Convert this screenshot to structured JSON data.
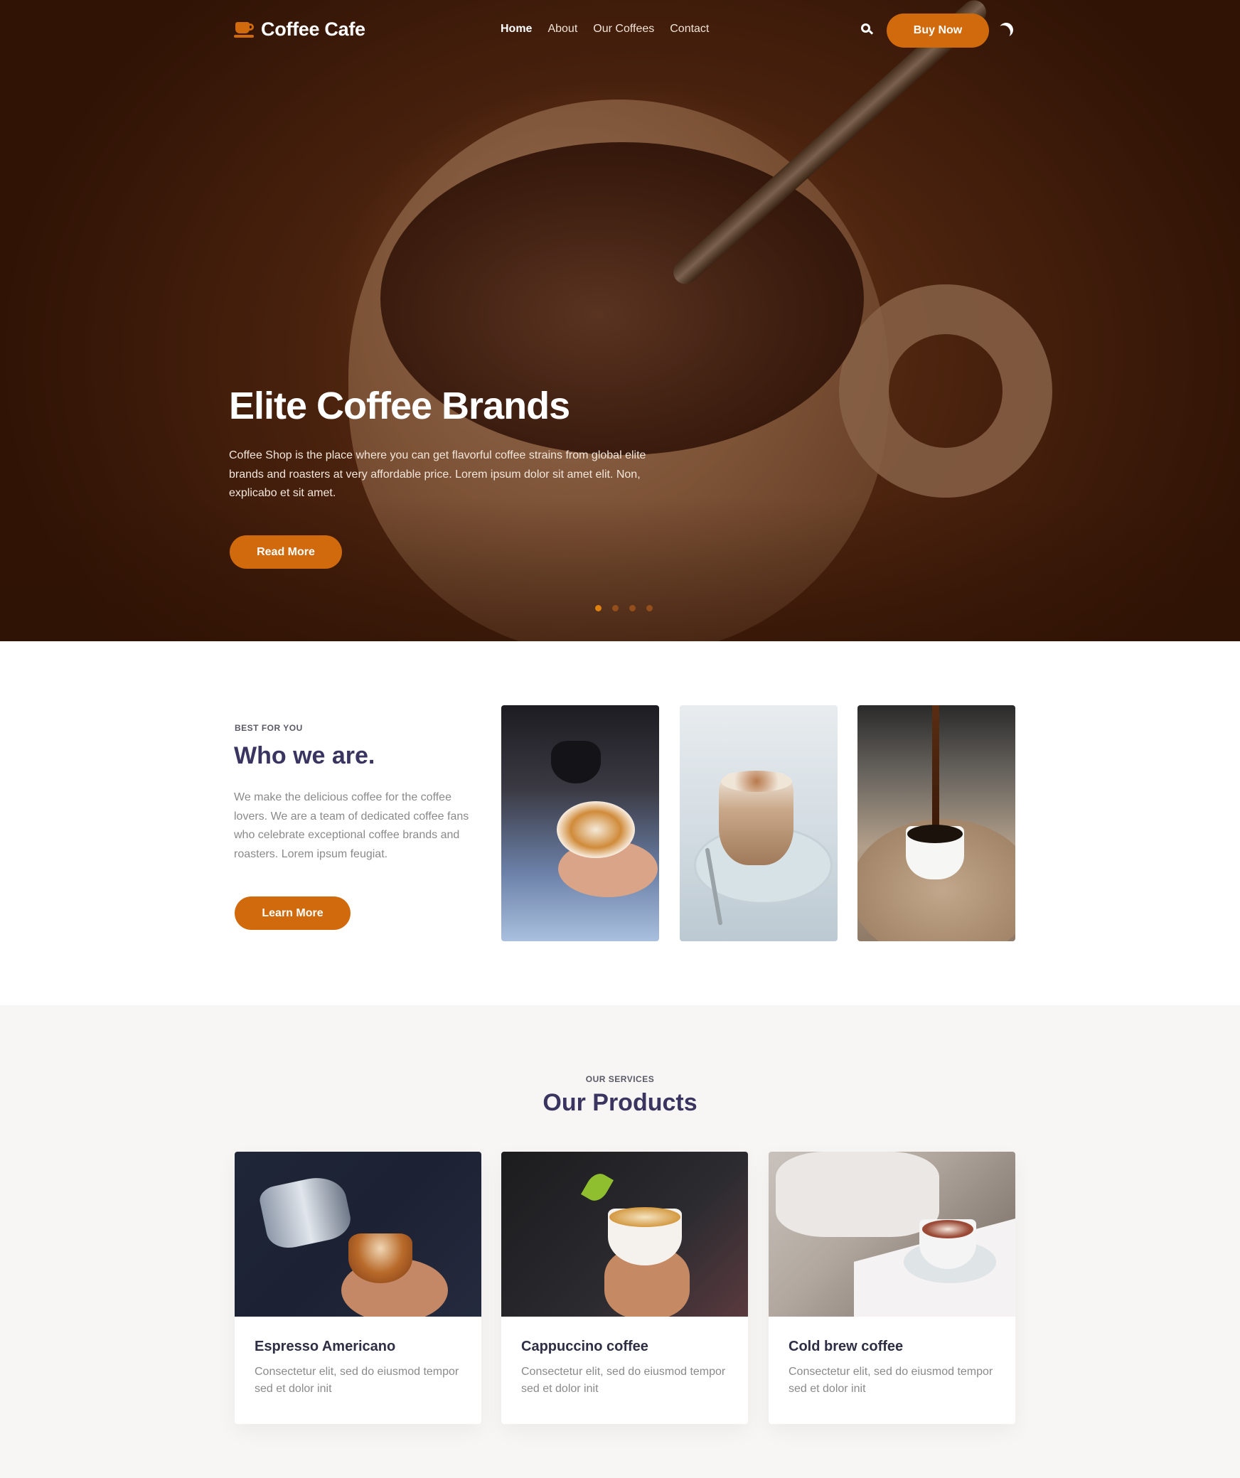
{
  "brand": {
    "name": "Coffee Cafe",
    "accent": "#d06a0c",
    "heading": "#3a3460"
  },
  "nav": {
    "items": [
      {
        "label": "Home",
        "active": true
      },
      {
        "label": "About",
        "active": false
      },
      {
        "label": "Our Coffees",
        "active": false
      },
      {
        "label": "Contact",
        "active": false
      }
    ],
    "search_icon": "search-icon",
    "buy_label": "Buy Now",
    "theme_icon": "moon-icon"
  },
  "hero": {
    "title": "Elite Coffee Brands",
    "description": "Coffee Shop is the place where you can get flavorful coffee strains from global elite brands and roasters at very affordable price. Lorem ipsum dolor sit amet elit. Non, explicabo et sit amet.",
    "button": "Read More",
    "slides": 4,
    "active_slide": 1
  },
  "about": {
    "eyebrow": "BEST FOR YOU",
    "title": "Who we are.",
    "description": "We make the delicious coffee for the coffee lovers. We are a team of dedicated coffee fans who celebrate exceptional coffee brands and roasters. Lorem ipsum feugiat.",
    "button": "Learn More",
    "images": [
      "latte-art-pour-photo",
      "cappuccino-glass-photo",
      "coffee-pour-cup-photo"
    ]
  },
  "products": {
    "eyebrow": "OUR SERVICES",
    "title": "Our Products",
    "items": [
      {
        "title": "Espresso Americano",
        "description": "Consectetur elit, sed do eiusmod tempor sed et dolor init"
      },
      {
        "title": "Cappuccino coffee",
        "description": "Consectetur elit, sed do eiusmod tempor sed et dolor init"
      },
      {
        "title": "Cold brew coffee",
        "description": "Consectetur elit, sed do eiusmod tempor sed et dolor init"
      }
    ]
  }
}
